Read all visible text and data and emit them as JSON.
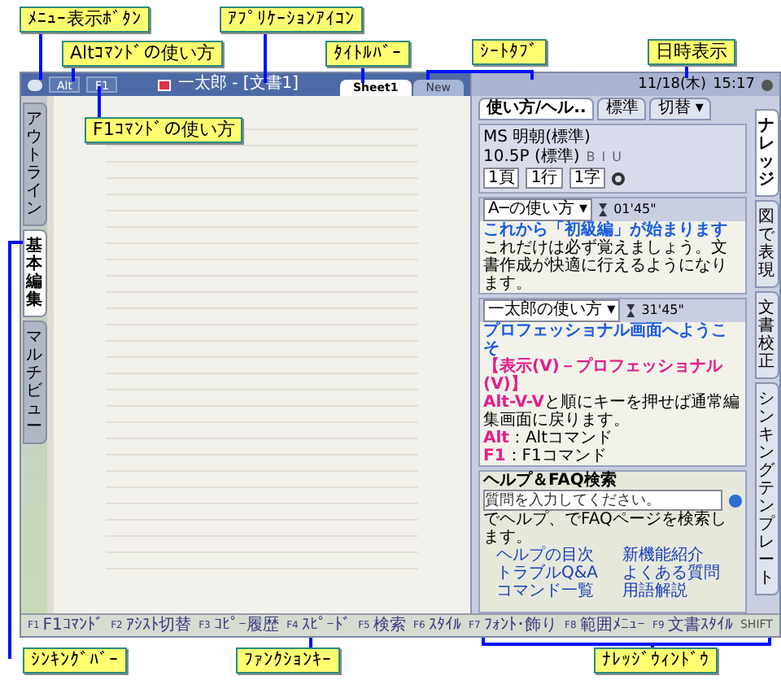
{
  "annotations": [
    {
      "text": "ﾒﾆｭｰ表示ﾎﾞﾀﾝ"
    },
    {
      "text": "Altｺﾏﾝﾄﾞの使い方"
    },
    {
      "text": "ｱﾌﾟﾘｹｰｼｮﾝｱｲｺﾝ"
    },
    {
      "text": "ﾀｲﾄﾙﾊﾞｰ"
    },
    {
      "text": "F1ｺﾏﾝﾄﾞの使い方"
    },
    {
      "text": "ｼｰﾄﾀﾌﾞ"
    },
    {
      "text": "日時表示"
    },
    {
      "text": "ｼﾝｷﾝｸﾞﾊﾞｰ"
    },
    {
      "text": "ﾌｧﾝｸｼｮﾝｷｰ"
    },
    {
      "text": "ﾅﾚｯｼﾞｳｨﾝﾄﾞｳ"
    }
  ],
  "window": {
    "title": "一太郎 - [文書1]",
    "commands": [
      "Alt",
      "F1"
    ],
    "sheet_tabs": [
      {
        "label": "Sheet1",
        "selected": true
      },
      {
        "label": "New",
        "selected": false
      }
    ]
  },
  "left_tabs": [
    {
      "label": "アウトライン",
      "selected": false
    },
    {
      "label": "基本編集",
      "selected": true
    },
    {
      "label": "マルチビュー",
      "selected": false
    }
  ],
  "function_keys": [
    {
      "key": "F1",
      "label": "F1ｺﾏﾝﾄﾞ"
    },
    {
      "key": "F2",
      "label": "ｱｼｽﾄ切替"
    },
    {
      "key": "F3",
      "label": "ｺﾋﾟｰ履歴"
    },
    {
      "key": "F4",
      "label": "ｽﾋﾟｰﾄﾞ"
    },
    {
      "key": "F5",
      "label": "検索"
    },
    {
      "key": "F6",
      "label": "ｽﾀｲﾙ"
    },
    {
      "key": "F7",
      "label": "ﾌｫﾝﾄ･飾り"
    },
    {
      "key": "F8",
      "label": "範囲ﾒﾆｭｰ"
    },
    {
      "key": "F9",
      "label": "文書ｽﾀｲﾙ"
    }
  ],
  "status_bar": {
    "shift": "SHIFT"
  },
  "knowledge_window": {
    "date": "11/18(木)",
    "time": "15:17",
    "tabs": [
      {
        "label": "使い方/ヘル..",
        "selected": true
      },
      {
        "label": "標準",
        "selected": false
      }
    ],
    "switch": "切替 ▾",
    "font": "MS 明朝(標準)",
    "size": "10.5P (標準)",
    "styles": [
      "B",
      "I",
      "U"
    ],
    "position": [
      "1頁",
      "1行",
      "1字"
    ],
    "panels": [
      {
        "title": "A─の使い方 ▾",
        "timer": "01'45\"",
        "heading": "これから「初級編」が始まります",
        "lines": [
          {
            "text": "これだけは必ず覚えましょう。文書作成が快適に行えるようになります。"
          }
        ]
      },
      {
        "title": "一太郎の使い方 ▾",
        "timer": "31'45\"",
        "heading": "プロフェッショナル画面へようこそ",
        "lines": [
          {
            "key": "【表示(V)－プロフェッショナル(V)】"
          },
          {
            "key": "Alt-V-V",
            "text": "と順にキーを押せば通常編集画面に戻ります。"
          },
          {
            "key": "Alt",
            "text": "：Altコマンド"
          },
          {
            "key": "F1",
            "text": "：F1コマンド"
          }
        ]
      }
    ],
    "help": {
      "title": "ヘルプ＆FAQ検索",
      "placeholder": "質問を入力してください。",
      "hint_help": "でヘルプ、",
      "hint_faq": "でFAQページを検索します。",
      "links": [
        "ヘルプの目次",
        "新機能紹介",
        "トラブルQ&A",
        "よくある質問",
        "コマンド一覧",
        "用語解説"
      ]
    },
    "side_tabs": [
      {
        "label": "ナレッジ",
        "selected": true
      },
      {
        "label": "図で表現",
        "selected": false
      },
      {
        "label": "文書校正",
        "selected": false
      },
      {
        "label": "シンキングテンプレート",
        "selected": false
      }
    ]
  }
}
